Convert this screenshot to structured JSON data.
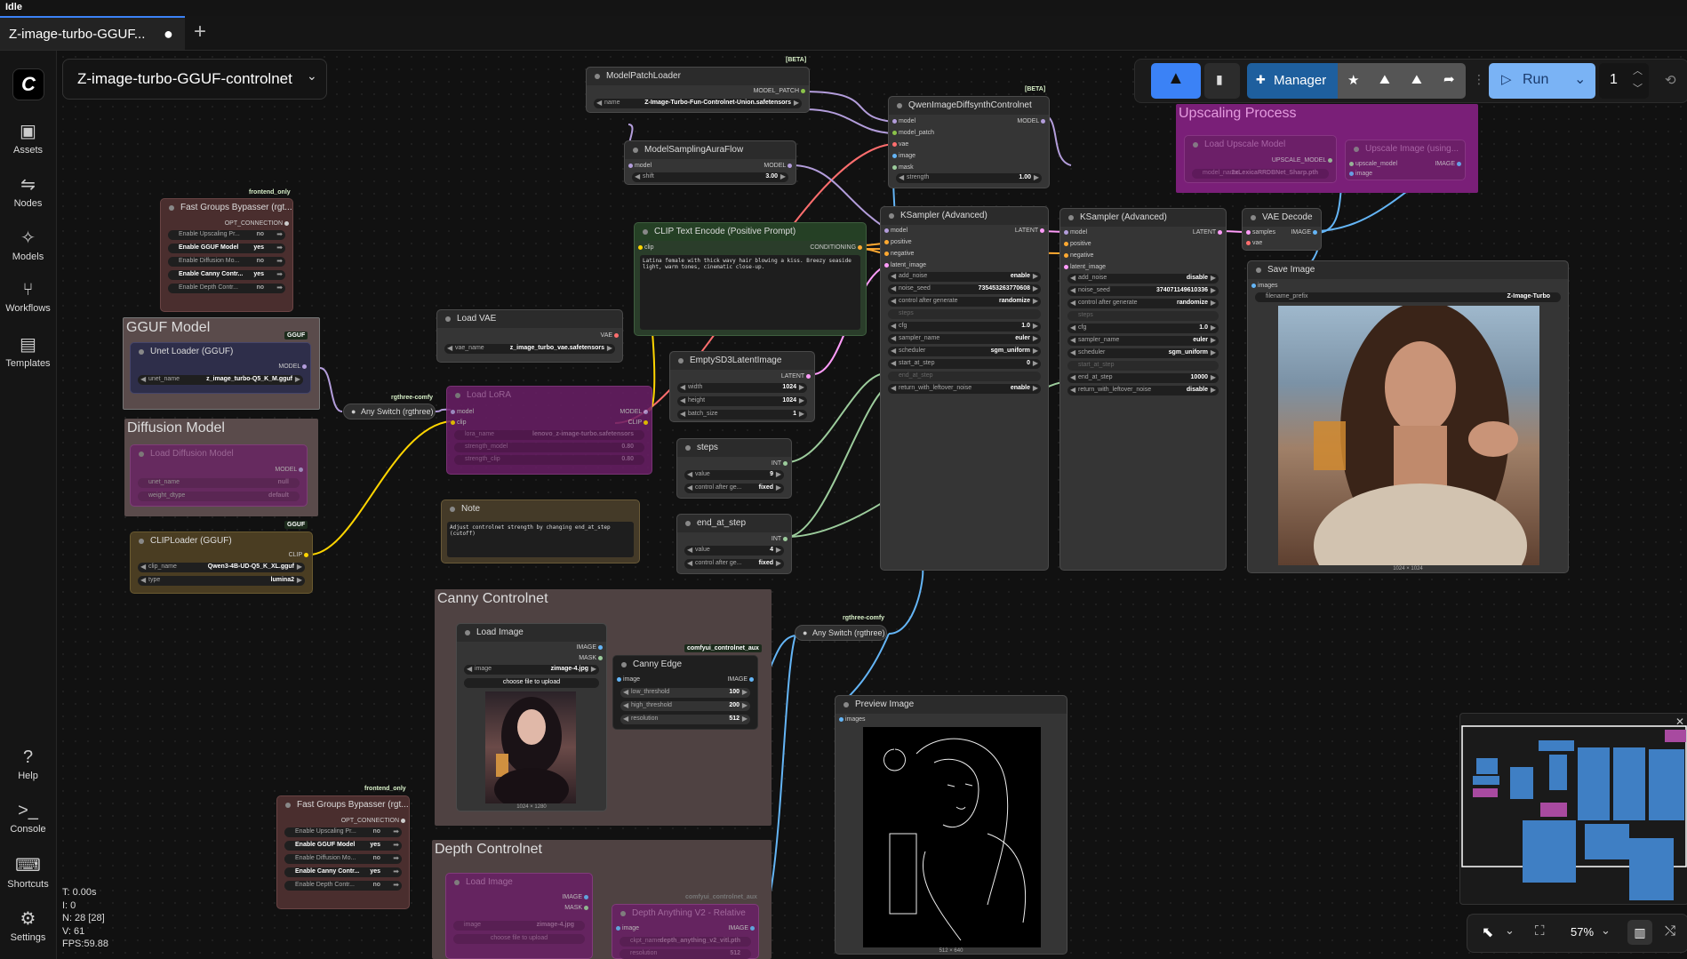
{
  "status": "Idle",
  "tab": {
    "title": "Z-image-turbo-GGUF...",
    "unsaved_dot": "●",
    "new_tab": "+"
  },
  "workflow_name": "Z-image-turbo-GGUF-controlnet",
  "sidebar": [
    {
      "label": "Assets",
      "icon": "image-icon"
    },
    {
      "label": "Nodes",
      "icon": "nodes-icon"
    },
    {
      "label": "Models",
      "icon": "models-icon"
    },
    {
      "label": "Workflows",
      "icon": "workflows-icon"
    },
    {
      "label": "Templates",
      "icon": "templates-icon"
    }
  ],
  "sidebar_bottom": [
    {
      "label": "Help",
      "icon": "help-icon"
    },
    {
      "label": "Console",
      "icon": "console-icon"
    },
    {
      "label": "Shortcuts",
      "icon": "keyboard-icon"
    },
    {
      "label": "Settings",
      "icon": "gear-icon"
    }
  ],
  "toolbar": {
    "manager": "Manager",
    "run": "Run",
    "queue_count": "1"
  },
  "stats": {
    "t": "T: 0.00s",
    "i": "I: 0",
    "n": "N: 28 [28]",
    "v": "V: 61",
    "fps": "FPS:59.88"
  },
  "zoom": "57%",
  "groups": {
    "gguf": "GGUF Model",
    "diffusion": "Diffusion Model",
    "upscaling": "Upscaling Process",
    "canny": "Canny Controlnet",
    "depth": "Depth Controlnet"
  },
  "tags": {
    "beta": "[BETA]",
    "frontend_only": "frontend_only",
    "rgthree": "rgthree-comfy",
    "gguf": "GGUF",
    "controlnet_aux": "comfyui_controlnet_aux"
  },
  "nodes": {
    "fast_bypasser": {
      "title": "Fast Groups Bypasser (rgt...",
      "output": "OPT_CONNECTION",
      "rows": [
        {
          "label": "Enable Upscaling Pr...",
          "value": "no"
        },
        {
          "label": "Enable GGUF Model",
          "value": "yes"
        },
        {
          "label": "Enable Diffusion Mo...",
          "value": "no"
        },
        {
          "label": "Enable Canny Contr...",
          "value": "yes"
        },
        {
          "label": "Enable Depth Contr...",
          "value": "no"
        }
      ]
    },
    "unet_loader": {
      "title": "Unet Loader (GGUF)",
      "output": "MODEL",
      "w_label": "unet_name",
      "w_value": "z_image_turbo-Q5_K_M.gguf"
    },
    "load_diffusion": {
      "title": "Load Diffusion Model",
      "output": "MODEL",
      "w1_label": "unet_name",
      "w1_value": "null",
      "w2_label": "weight_dtype",
      "w2_value": "default"
    },
    "clip_loader": {
      "title": "CLIPLoader (GGUF)",
      "output": "CLIP",
      "w1_label": "clip_name",
      "w1_value": "Qwen3-4B-UD-Q5_K_XL.gguf",
      "w2_label": "type",
      "w2_value": "lumina2"
    },
    "model_patch": {
      "title": "ModelPatchLoader",
      "output": "MODEL_PATCH",
      "w_label": "name",
      "w_value": "Z-Image-Turbo-Fun-Controlnet-Union.safetensors"
    },
    "sampling_aura": {
      "title": "ModelSamplingAuraFlow",
      "input": "model",
      "output": "MODEL",
      "w_label": "shift",
      "w_value": "3.00"
    },
    "qwen_cn": {
      "title": "QwenImageDiffsynthControlnet",
      "inputs": [
        "model",
        "model_patch",
        "vae",
        "image",
        "mask"
      ],
      "output": "MODEL",
      "w_label": "strength",
      "w_value": "1.00"
    },
    "clip_text": {
      "title": "CLIP Text Encode (Positive Prompt)",
      "input": "clip",
      "output": "CONDITIONING",
      "text": "Latina female with thick wavy hair blowing a kiss. Breezy seaside light, warm tones, cinematic close-up."
    },
    "load_vae": {
      "title": "Load VAE",
      "output": "VAE",
      "w_label": "vae_name",
      "w_value": "z_image_turbo_vae.safetensors"
    },
    "any_switch1": {
      "title": "Any Switch (rgthree)"
    },
    "load_lora": {
      "title": "Load LoRA",
      "inputs": [
        "model",
        "clip"
      ],
      "outputs": [
        "MODEL",
        "CLIP"
      ],
      "w1_label": "lora_name",
      "w1_value": "lenovo_z-image-turbo.safetensors",
      "w2_label": "strength_model",
      "w2_value": "0.80",
      "w3_label": "strength_clip",
      "w3_value": "0.80"
    },
    "empty_latent": {
      "title": "EmptySD3LatentImage",
      "output": "LATENT",
      "rows": [
        {
          "label": "width",
          "value": "1024"
        },
        {
          "label": "height",
          "value": "1024"
        },
        {
          "label": "batch_size",
          "value": "1"
        }
      ]
    },
    "steps": {
      "title": "steps",
      "output": "INT",
      "rows": [
        {
          "label": "value",
          "value": "9"
        },
        {
          "label": "control after ge...",
          "value": "fixed"
        }
      ]
    },
    "end_at_step": {
      "title": "end_at_step",
      "output": "INT",
      "rows": [
        {
          "label": "value",
          "value": "4"
        },
        {
          "label": "control after ge...",
          "value": "fixed"
        }
      ]
    },
    "note": {
      "title": "Note",
      "text": "Adjust controlnet strength by changing end_at_step (cutoff)"
    },
    "ksampler1": {
      "title": "KSampler (Advanced)",
      "inputs": [
        "model",
        "positive",
        "negative",
        "latent_image"
      ],
      "output": "LATENT",
      "rows": [
        {
          "label": "add_noise",
          "value": "enable"
        },
        {
          "label": "noise_seed",
          "value": "735453263770608"
        },
        {
          "label": "control after generate",
          "value": "randomize"
        },
        {
          "label": "steps",
          "value": ""
        },
        {
          "label": "cfg",
          "value": "1.0"
        },
        {
          "label": "sampler_name",
          "value": "euler"
        },
        {
          "label": "scheduler",
          "value": "sgm_uniform"
        },
        {
          "label": "start_at_step",
          "value": "0"
        },
        {
          "label": "end_at_step",
          "value": ""
        },
        {
          "label": "return_with_leftover_noise",
          "value": "enable"
        }
      ]
    },
    "ksampler2": {
      "title": "KSampler (Advanced)",
      "inputs": [
        "model",
        "positive",
        "negative",
        "latent_image"
      ],
      "output": "LATENT",
      "rows": [
        {
          "label": "add_noise",
          "value": "disable"
        },
        {
          "label": "noise_seed",
          "value": "374071149610336"
        },
        {
          "label": "control after generate",
          "value": "randomize"
        },
        {
          "label": "steps",
          "value": ""
        },
        {
          "label": "cfg",
          "value": "1.0"
        },
        {
          "label": "sampler_name",
          "value": "euler"
        },
        {
          "label": "scheduler",
          "value": "sgm_uniform"
        },
        {
          "label": "start_at_step",
          "value": ""
        },
        {
          "label": "end_at_step",
          "value": "10000"
        },
        {
          "label": "return_with_leftover_noise",
          "value": "disable"
        }
      ]
    },
    "vae_decode": {
      "title": "VAE Decode",
      "inputs": [
        "samples",
        "vae"
      ],
      "output": "IMAGE"
    },
    "save_image": {
      "title": "Save Image",
      "input": "images",
      "w_label": "filename_prefix",
      "w_value": "Z-Image-Turbo",
      "size": "1024 × 1024"
    },
    "load_upscale": {
      "title": "Load Upscale Model",
      "output": "UPSCALE_MODEL",
      "w_label": "model_name",
      "w_value": "2xLexicaRRDBNet_Sharp.pth"
    },
    "upscale_image": {
      "title": "Upscale Image (using...",
      "inputs": [
        "upscale_model",
        "image"
      ],
      "output": "IMAGE"
    },
    "load_image": {
      "title": "Load Image",
      "outputs": [
        "IMAGE",
        "MASK"
      ],
      "w_label": "image",
      "w_value": "zimage-4.jpg",
      "upload": "choose file to upload",
      "size": "1024 × 1280"
    },
    "canny": {
      "title": "Canny Edge",
      "input": "image",
      "output": "IMAGE",
      "rows": [
        {
          "label": "low_threshold",
          "value": "100"
        },
        {
          "label": "high_threshold",
          "value": "200"
        },
        {
          "label": "resolution",
          "value": "512"
        }
      ]
    },
    "any_switch2": {
      "title": "Any Switch (rgthree)"
    },
    "preview": {
      "title": "Preview Image",
      "input": "images",
      "size": "512 × 640"
    },
    "fast_bypasser2": {
      "title": "Fast Groups Bypasser (rgt...",
      "output": "OPT_CONNECTION",
      "rows": [
        {
          "label": "Enable Upscaling Pr...",
          "value": "no"
        },
        {
          "label": "Enable GGUF Model",
          "value": "yes"
        },
        {
          "label": "Enable Diffusion Mo...",
          "value": "no"
        },
        {
          "label": "Enable Canny Contr...",
          "value": "yes"
        },
        {
          "label": "Enable Depth Contr...",
          "value": "no"
        }
      ]
    },
    "load_image_depth": {
      "title": "Load Image",
      "outputs": [
        "IMAGE",
        "MASK"
      ],
      "w_label": "image",
      "w_value": "zimage-4.jpg",
      "upload": "choose file to upload"
    },
    "depth_anything": {
      "title": "Depth Anything V2 - Relative",
      "input": "image",
      "output": "IMAGE",
      "w1_label": "ckpt_name",
      "w1_value": "depth_anything_v2_vitl.pth",
      "w2_label": "resolution",
      "w2_value": "512"
    }
  }
}
